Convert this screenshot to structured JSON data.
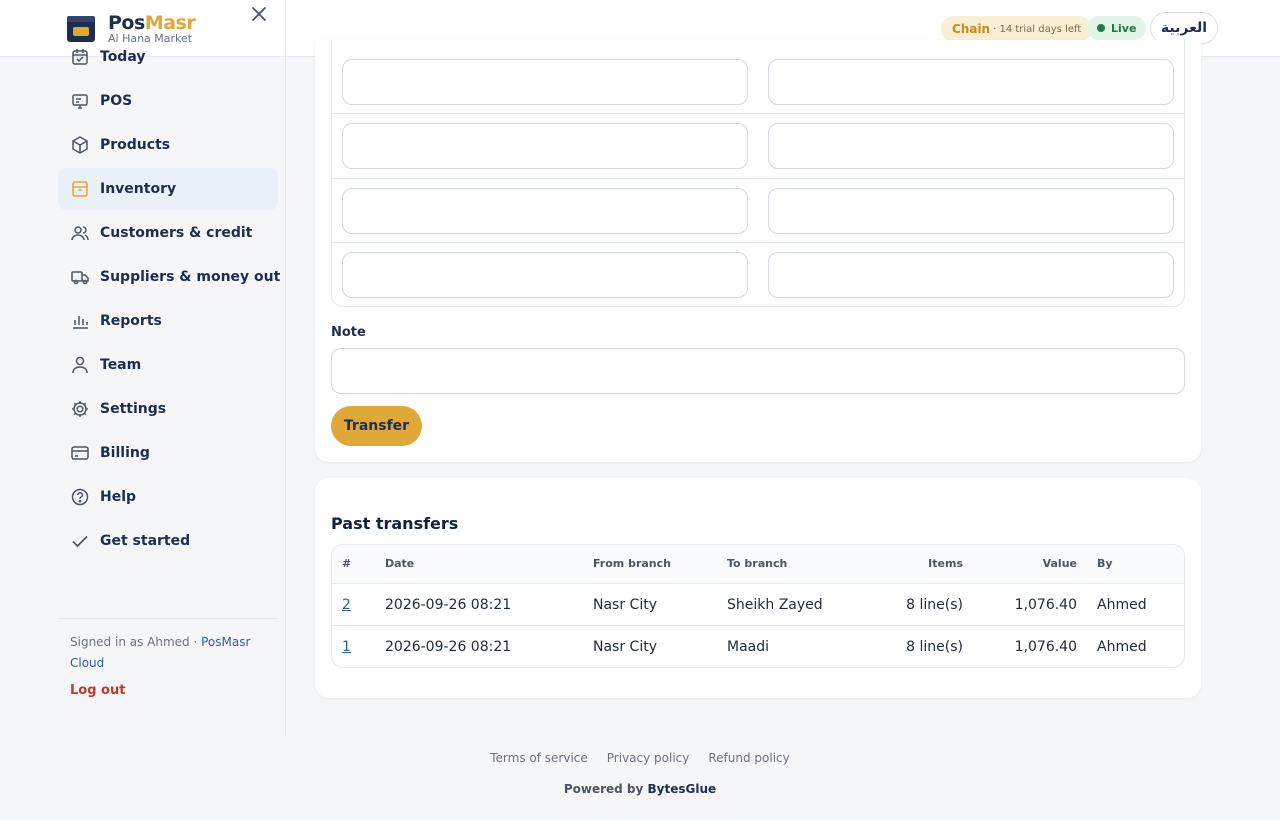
{
  "brand": {
    "name_part1": "Pos",
    "name_part2": "Masr",
    "store": "Al Hana Market"
  },
  "header": {
    "trial_chain": "Chain",
    "trial_days": "· 14 trial days left",
    "live_label": "Live",
    "language_button": "العربية"
  },
  "sidebar": {
    "items": [
      {
        "label": "Today",
        "icon": "calendar-icon"
      },
      {
        "label": "POS",
        "icon": "monitor-icon"
      },
      {
        "label": "Products",
        "icon": "box-icon"
      },
      {
        "label": "Inventory",
        "icon": "archive-icon",
        "active": true
      },
      {
        "label": "Customers & credit",
        "icon": "users-icon"
      },
      {
        "label": "Suppliers & money out",
        "icon": "truck-icon"
      },
      {
        "label": "Reports",
        "icon": "bar-chart-icon"
      },
      {
        "label": "Team",
        "icon": "user-icon"
      },
      {
        "label": "Settings",
        "icon": "gear-icon"
      },
      {
        "label": "Billing",
        "icon": "credit-card-icon"
      },
      {
        "label": "Help",
        "icon": "help-circle-icon"
      },
      {
        "label": "Get started",
        "icon": "check-icon"
      }
    ],
    "signed_in_prefix": "Signed in as Ahmed · ",
    "signed_in_org": "PosMasr Cloud",
    "logout": "Log out"
  },
  "transfer_form": {
    "note_label": "Note",
    "note_value": "",
    "transfer_button": "Transfer"
  },
  "past_transfers": {
    "title": "Past transfers",
    "columns": [
      "#",
      "Date",
      "From branch",
      "To branch",
      "Items",
      "Value",
      "By"
    ],
    "rows": [
      [
        "2",
        "2026-09-26 08:21",
        "Nasr City",
        "Sheikh Zayed",
        "8 line(s)",
        "1,076.40",
        "Ahmed"
      ],
      [
        "1",
        "2026-09-26 08:21",
        "Nasr City",
        "Maadi",
        "8 line(s)",
        "1,076.40",
        "Ahmed"
      ]
    ]
  },
  "footer": {
    "links": [
      "Terms of service",
      "Privacy policy",
      "Refund policy"
    ],
    "powered_prefix": "Powered by ",
    "powered_brand": "BytesGlue"
  },
  "colors": {
    "accent": "#e0a836",
    "navy": "#1c2e4e",
    "live": "#1e7a44",
    "logout": "#c0392b"
  }
}
